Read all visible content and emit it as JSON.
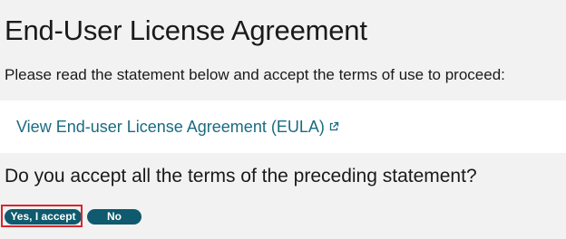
{
  "page": {
    "title": "End-User License Agreement",
    "instruction": "Please read the statement below and accept the terms of use to proceed:",
    "eula_link_label": "View End-user License Agreement (EULA)",
    "question": "Do you accept all the terms of the preceding statement?"
  },
  "actions": {
    "accept_label": "Yes, I accept",
    "decline_label": "No"
  },
  "icons": {
    "eula_link": "external-link-icon"
  },
  "colors": {
    "link": "#1a6b81",
    "button": "#0f5a6e",
    "highlight": "#d9262b"
  }
}
